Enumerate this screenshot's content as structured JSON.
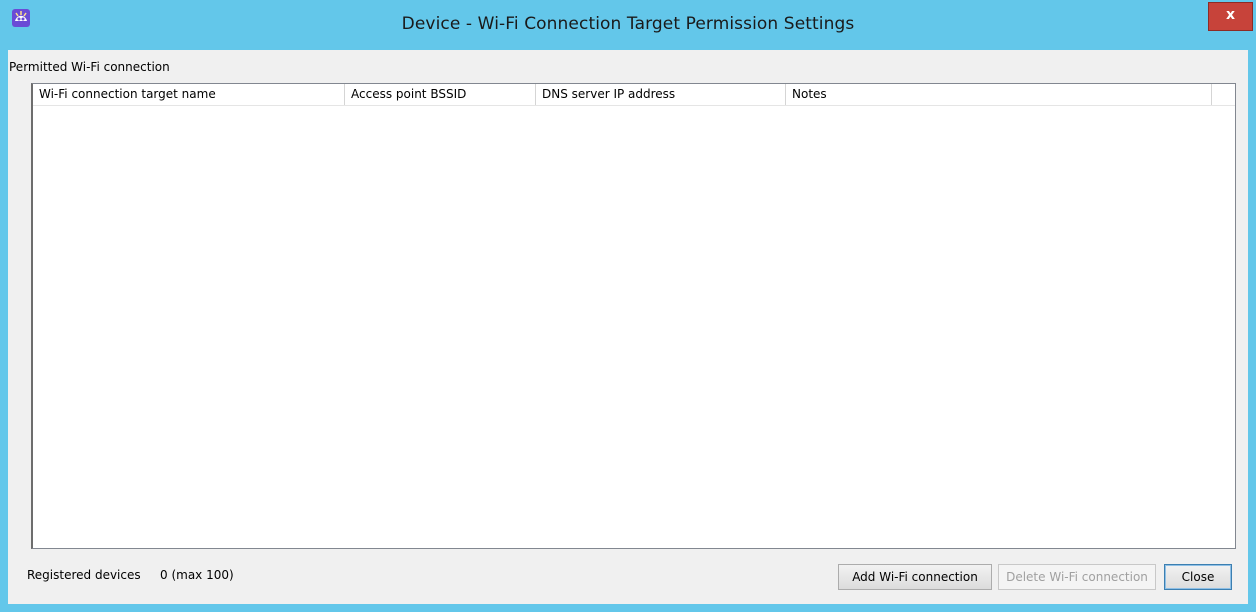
{
  "window": {
    "title": "Device - Wi-Fi Connection Target Permission Settings",
    "close_label": "x",
    "app_icon": "app-logo-icon",
    "frame_color": "#63c7ea"
  },
  "section": {
    "label": "Permitted Wi-Fi connection"
  },
  "table": {
    "columns": [
      "Wi-Fi connection target name",
      "Access point BSSID",
      "DNS server IP address",
      "Notes",
      ""
    ],
    "rows": []
  },
  "footer": {
    "registered_label": "Registered devices",
    "registered_count": "0 (max 100)"
  },
  "buttons": {
    "add": "Add Wi-Fi connection",
    "delete": "Delete Wi-Fi connection",
    "close": "Close"
  }
}
